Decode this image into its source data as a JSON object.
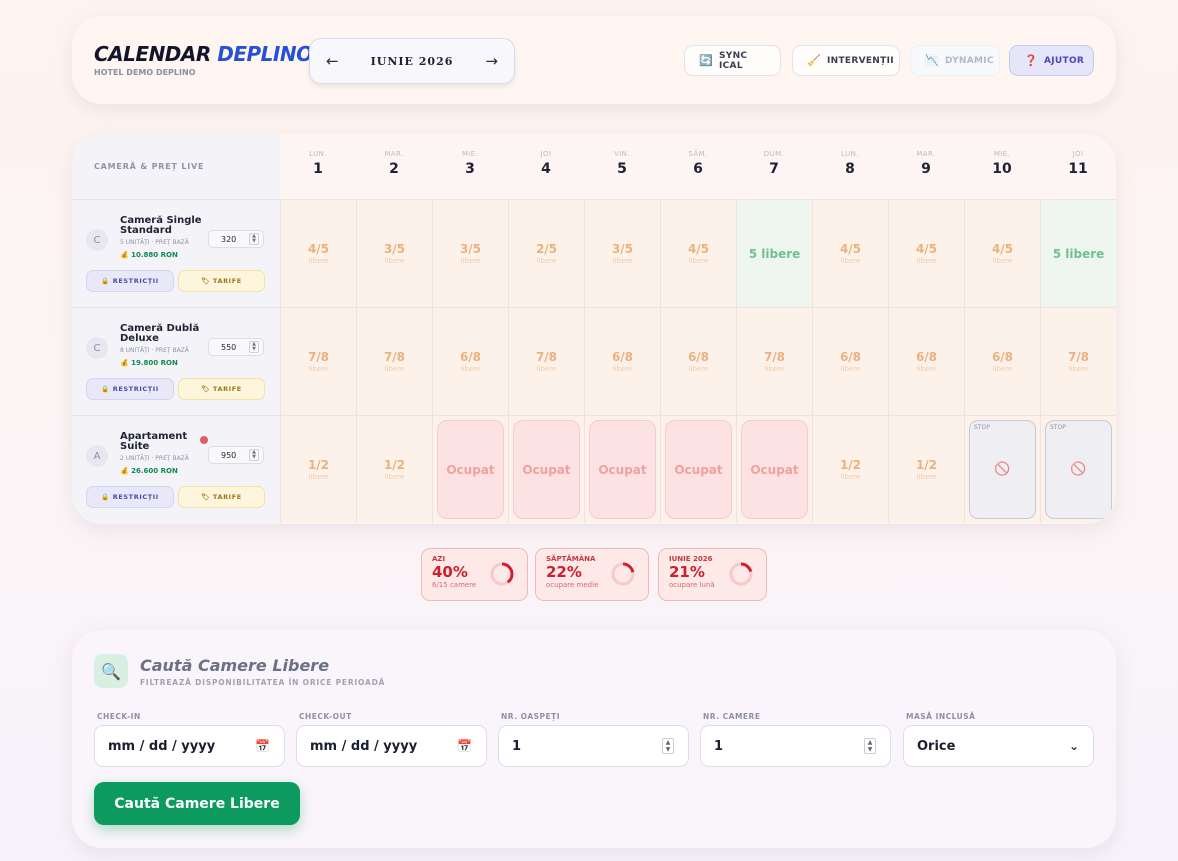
{
  "header": {
    "brand_main": "CALENDAR",
    "brand_accent": "DEPLINO",
    "hotel": "HOTEL DEMO DEPLINO",
    "prev_arrow": "←",
    "next_arrow": "→",
    "month": "IUNIE 2026",
    "buttons": {
      "sync": {
        "icon": "🔄",
        "label": "SYNC ICAL"
      },
      "interventii": {
        "icon": "🧹",
        "label": "INTERVENȚII"
      },
      "dynamic": {
        "icon": "📉",
        "label": "DYNAMIC"
      },
      "help": {
        "icon": "❓",
        "label": "AJUTOR"
      }
    }
  },
  "calendar": {
    "corner_label": "CAMERĂ & PREȚ LIVE",
    "days": [
      {
        "name": "LUN.",
        "num": "1"
      },
      {
        "name": "MAR.",
        "num": "2"
      },
      {
        "name": "MIE.",
        "num": "3"
      },
      {
        "name": "JOI",
        "num": "4"
      },
      {
        "name": "VIN.",
        "num": "5"
      },
      {
        "name": "SÂM.",
        "num": "6"
      },
      {
        "name": "DUM.",
        "num": "7"
      },
      {
        "name": "LUN.",
        "num": "8"
      },
      {
        "name": "MAR.",
        "num": "9"
      },
      {
        "name": "MIE.",
        "num": "10"
      },
      {
        "name": "JOI",
        "num": "11"
      }
    ],
    "free_label": "libere",
    "rooms": [
      {
        "avatar": "C",
        "name": "Cameră Single Standard",
        "sub": "5 UNITĂȚI · PREȚ BAZĂ",
        "revenue": "💰 10.880 RON",
        "price": "320",
        "restrictii": "🔒 RESTRICȚII",
        "tarife": "🏷 TARIFE",
        "cells": [
          {
            "type": "avail",
            "value": "4/5"
          },
          {
            "type": "avail",
            "value": "3/5"
          },
          {
            "type": "avail",
            "value": "3/5"
          },
          {
            "type": "avail",
            "value": "2/5"
          },
          {
            "type": "avail",
            "value": "3/5"
          },
          {
            "type": "avail",
            "value": "4/5"
          },
          {
            "type": "free",
            "value": "5 libere"
          },
          {
            "type": "avail",
            "value": "4/5"
          },
          {
            "type": "avail",
            "value": "4/5"
          },
          {
            "type": "avail",
            "value": "4/5"
          },
          {
            "type": "free",
            "value": "5 libere"
          }
        ]
      },
      {
        "avatar": "C",
        "name": "Cameră Dublă Deluxe",
        "sub": "8 UNITĂȚI · PREȚ BAZĂ",
        "revenue": "💰 19.800 RON",
        "price": "550",
        "restrictii": "🔒 RESTRICȚII",
        "tarife": "🏷 TARIFE",
        "cells": [
          {
            "type": "avail",
            "value": "7/8"
          },
          {
            "type": "avail",
            "value": "7/8"
          },
          {
            "type": "avail",
            "value": "6/8"
          },
          {
            "type": "avail",
            "value": "7/8"
          },
          {
            "type": "avail",
            "value": "6/8"
          },
          {
            "type": "avail",
            "value": "6/8"
          },
          {
            "type": "avail",
            "value": "7/8"
          },
          {
            "type": "avail",
            "value": "6/8"
          },
          {
            "type": "avail",
            "value": "6/8"
          },
          {
            "type": "avail",
            "value": "6/8"
          },
          {
            "type": "avail",
            "value": "7/8"
          }
        ]
      },
      {
        "avatar": "A",
        "name": "Apartament Suite",
        "sub": "2 UNITĂȚI · PREȚ BAZĂ",
        "revenue": "💰 26.600 RON",
        "price": "950",
        "restrictii": "🔒 RESTRICȚII",
        "tarife": "🏷 TARIFE",
        "cells": [
          {
            "type": "avail",
            "value": "1/2"
          },
          {
            "type": "avail",
            "value": "1/2"
          },
          {
            "type": "occ",
            "value": "Ocupat"
          },
          {
            "type": "occ",
            "value": "Ocupat"
          },
          {
            "type": "occ",
            "value": "Ocupat"
          },
          {
            "type": "occ",
            "value": "Ocupat"
          },
          {
            "type": "occ",
            "value": "Ocupat"
          },
          {
            "type": "avail",
            "value": "1/2"
          },
          {
            "type": "avail",
            "value": "1/2"
          },
          {
            "type": "stop",
            "value": "STOP"
          },
          {
            "type": "stop",
            "value": "STOP"
          }
        ]
      }
    ]
  },
  "occupancy": [
    {
      "label": "AZI",
      "percent": "40%",
      "value": 40,
      "sub": "6/15 camere"
    },
    {
      "label": "SĂPTĂMÂNA",
      "percent": "22%",
      "value": 22,
      "sub": "ocupare medie"
    },
    {
      "label": "IUNIE 2026",
      "percent": "21%",
      "value": 21,
      "sub": "ocupare lună"
    }
  ],
  "search": {
    "icon": "🔍",
    "title": "Caută Camere Libere",
    "subtitle": "FILTREAZĂ DISPONIBILITATEA ÎN ORICE PERIOADĂ",
    "checkin_label": "CHECK-IN",
    "checkin_value": "mm / dd / yyyy",
    "checkout_label": "CHECK-OUT",
    "checkout_value": "mm / dd / yyyy",
    "guests_label": "NR. OASPEȚI",
    "guests_value": "1",
    "rooms_label": "NR. CAMERE",
    "rooms_value": "1",
    "meal_label": "MASĂ INCLUSĂ",
    "meal_value": "Orice",
    "button": "Caută Camere Libere"
  }
}
